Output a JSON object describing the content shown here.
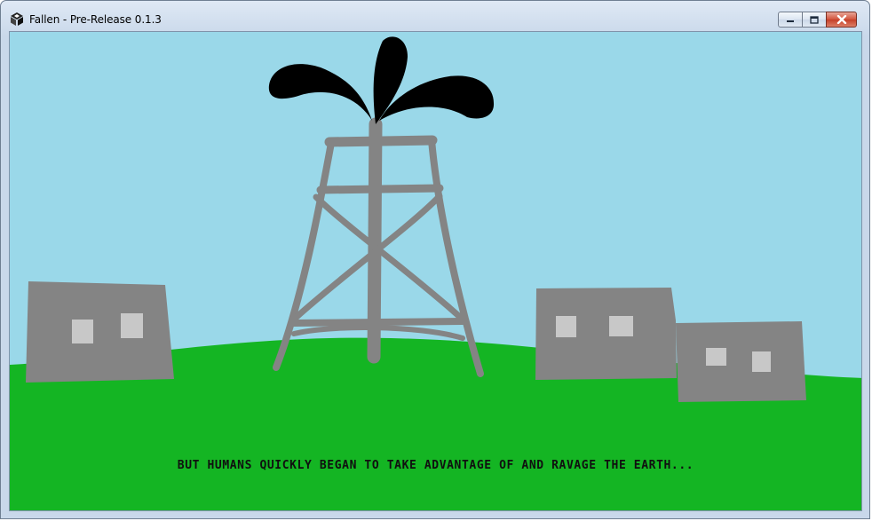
{
  "window": {
    "title": "Fallen - Pre-Release 0.1.3",
    "app_icon": "fallen-app-icon",
    "controls": {
      "minimize_icon": "minimize-icon",
      "maximize_icon": "restore-icon",
      "close_icon": "close-icon"
    }
  },
  "scene": {
    "caption": "BUT HUMANS QUICKLY BEGAN TO TAKE ADVANTAGE OF AND RAVAGE THE EARTH...",
    "colors": {
      "sky": "#9ad8e9",
      "grass": "#14b523",
      "structure": "#848484",
      "window_pane": "#c8c8c8",
      "oil": "#000000"
    }
  }
}
